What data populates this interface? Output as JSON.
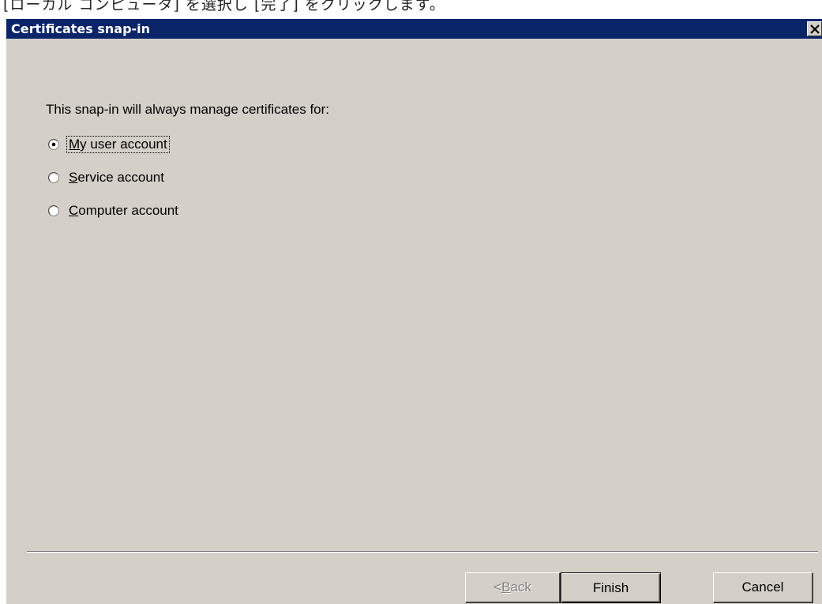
{
  "caption": {
    "text": "[ローカル コンピュータ] を選択し [完了] をクリックします。"
  },
  "window": {
    "title": "Certificates snap-in",
    "close_icon": "close-x-icon"
  },
  "content": {
    "prompt": "This snap-in will always manage certificates for:",
    "options": [
      {
        "pre": "",
        "accel": "M",
        "post": "y user account",
        "checked": true
      },
      {
        "pre": "",
        "accel": "S",
        "post": "ervice account",
        "checked": false
      },
      {
        "pre": "",
        "accel": "C",
        "post": "omputer account",
        "checked": false
      }
    ]
  },
  "buttons": {
    "back": {
      "pre": "< ",
      "accel": "B",
      "post": "ack",
      "enabled": false
    },
    "finish": {
      "label": "Finish"
    },
    "cancel": {
      "label": "Cancel"
    }
  }
}
